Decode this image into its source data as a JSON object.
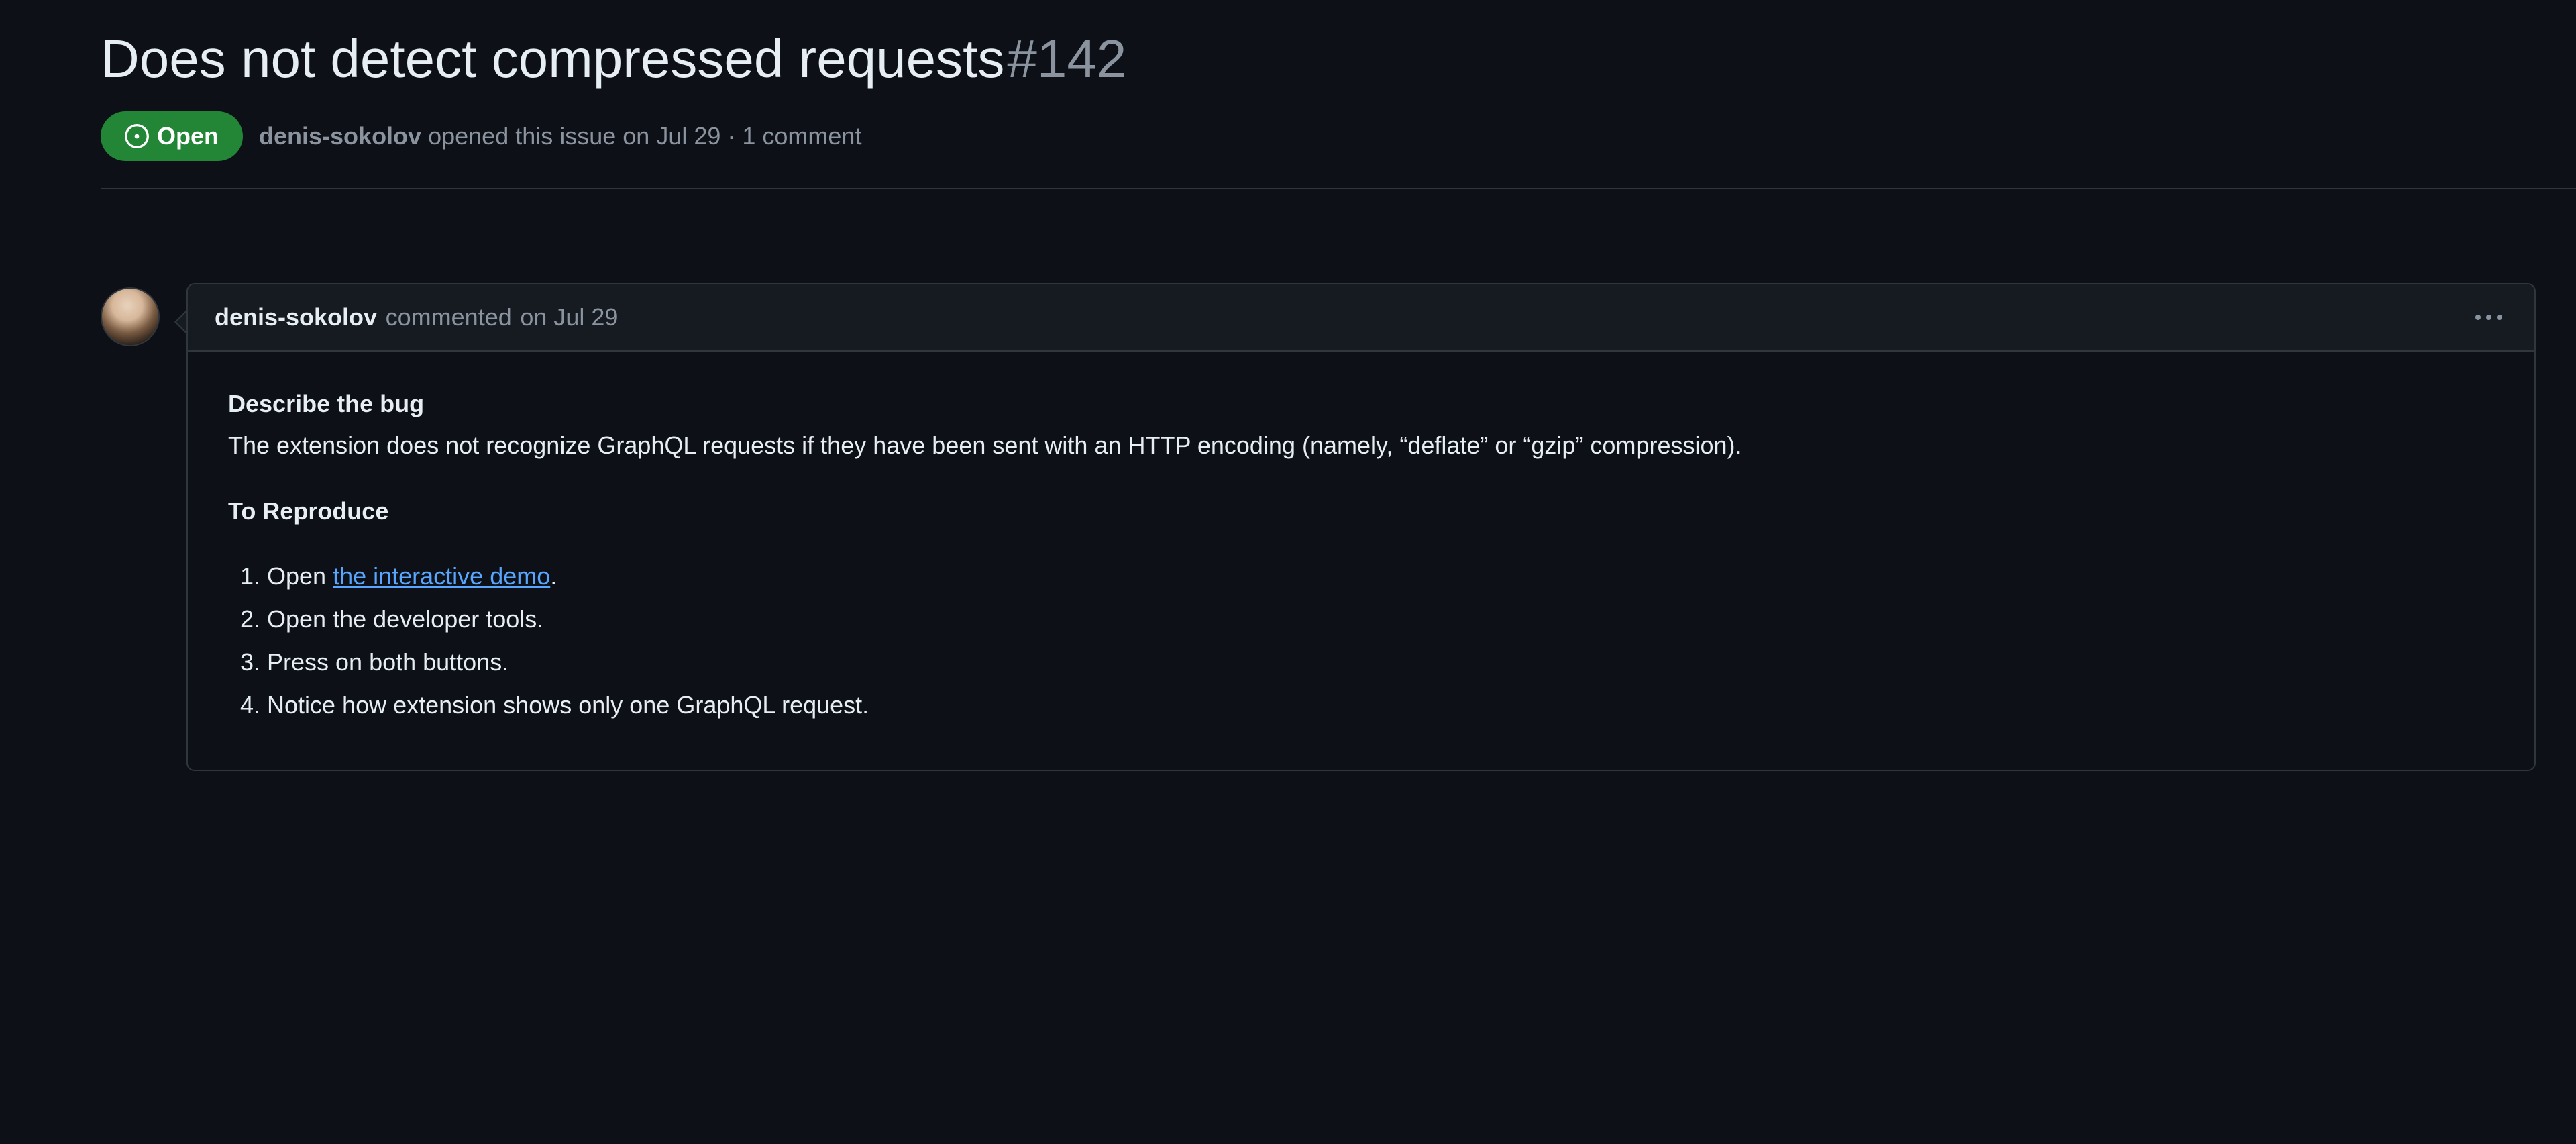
{
  "issue": {
    "title": "Does not detect compressed requests",
    "number": "#142",
    "status_label": "Open",
    "author": "denis-sokolov",
    "meta_opened": " opened this issue ",
    "meta_date": "on Jul 29",
    "meta_separator": " · ",
    "meta_comments": "1 comment"
  },
  "comment": {
    "author": "denis-sokolov",
    "action": " commented ",
    "date": "on Jul 29",
    "body": {
      "heading_describe": "Describe the bug",
      "describe_text": "The extension does not recognize GraphQL requests if they have been sent with an HTTP encoding (namely, “deflate” or “gzip” compression).",
      "heading_reproduce": "To Reproduce",
      "steps": {
        "s1_prefix": "Open ",
        "s1_link": "the interactive demo",
        "s1_suffix": ".",
        "s2": "Open the developer tools.",
        "s3": "Press on both buttons.",
        "s4": "Notice how extension shows only one GraphQL request."
      }
    }
  },
  "colors": {
    "bg": "#0d1117",
    "panel": "#161b22",
    "border": "#30363d",
    "text": "#e6edf3",
    "muted": "#8b949e",
    "link": "#58a6ff",
    "open_badge": "#238636"
  }
}
